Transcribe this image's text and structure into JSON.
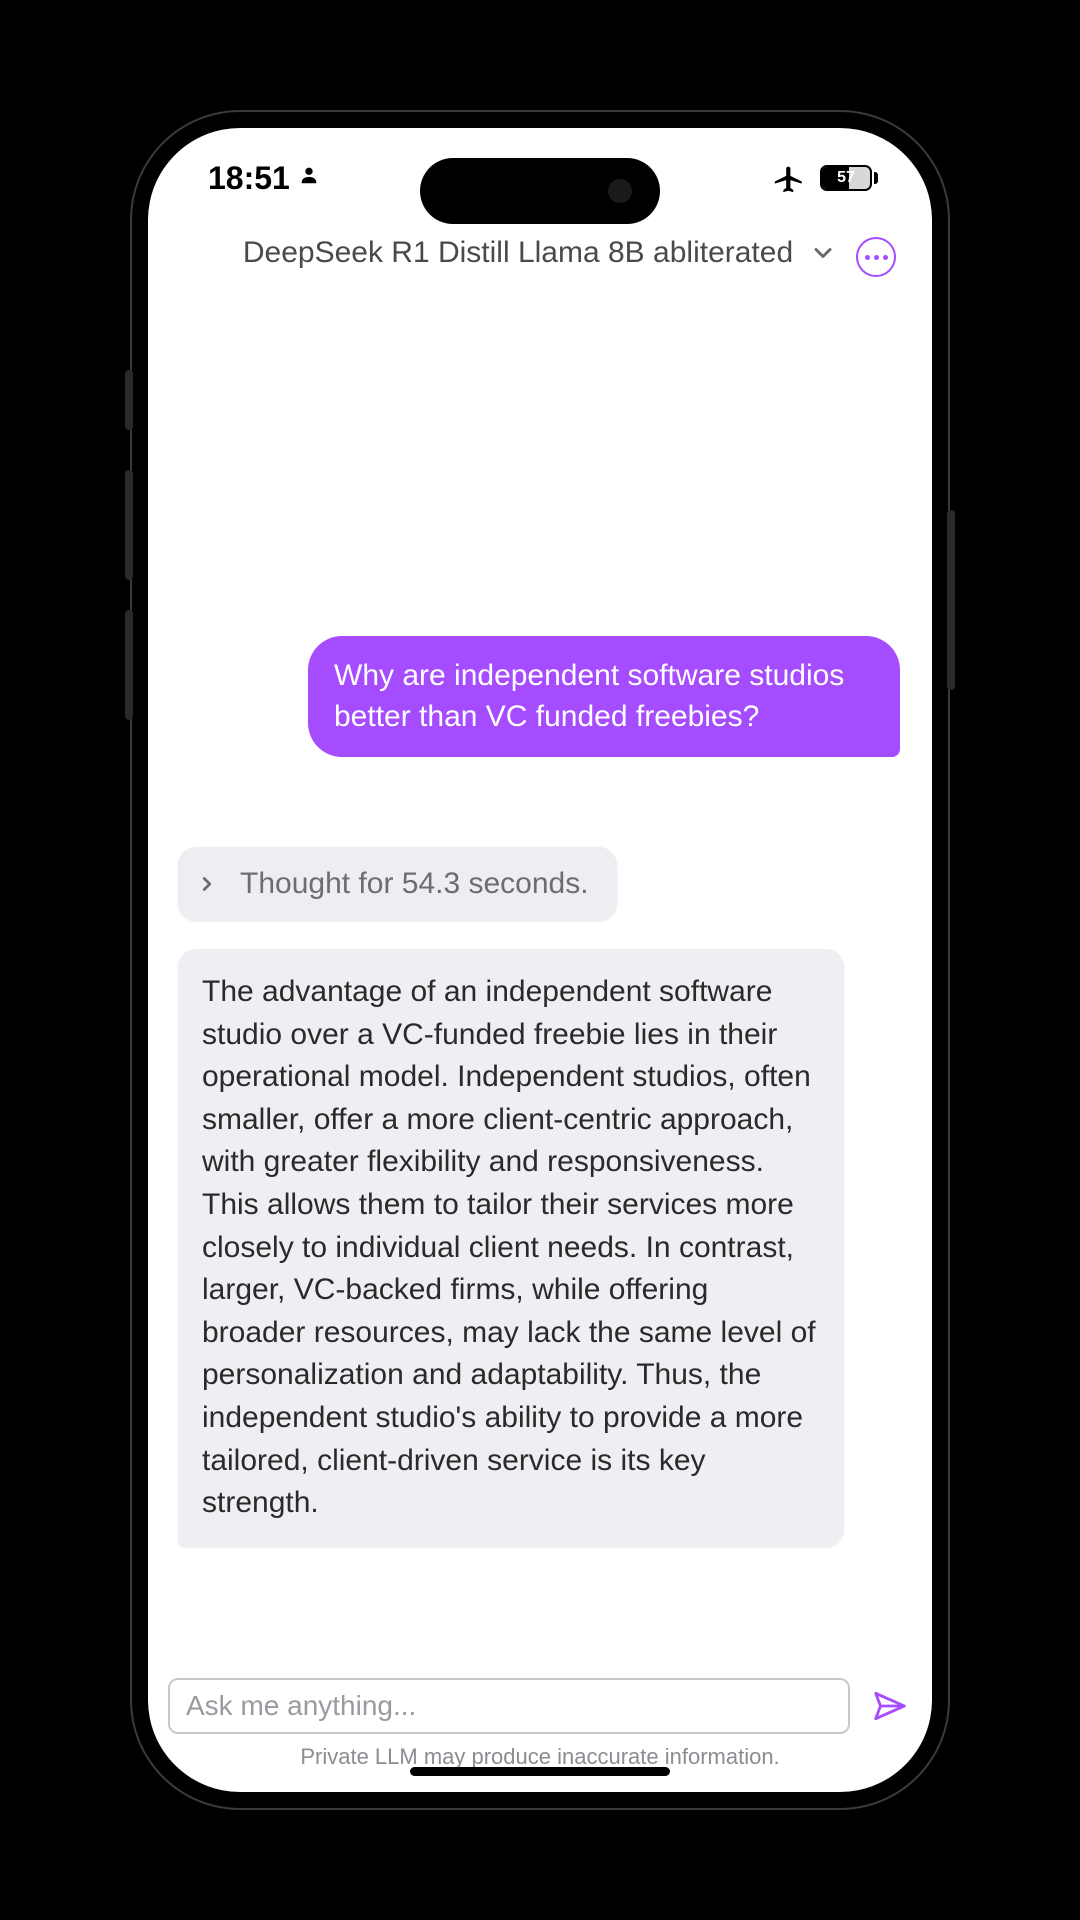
{
  "status": {
    "time": "18:51",
    "battery_pct": "57"
  },
  "header": {
    "model_name": "DeepSeek R1 Distill Llama 8B abliterated"
  },
  "chat": {
    "user_message": "Why are independent software studios better than VC funded freebies?",
    "thought_label": "Thought for 54.3 seconds.",
    "assistant_message": "The advantage of an independent software studio over a VC-funded freebie lies in their operational model. Independent studios, often smaller, offer a more client-centric approach, with greater flexibility and responsiveness. This allows them to tailor their services more closely to individual client needs. In contrast, larger, VC-backed firms, while offering broader resources, may lack the same level of personalization and adaptability. Thus, the independent studio's ability to provide a more tailored, client-driven service is its key strength."
  },
  "input": {
    "placeholder": "Ask me anything..."
  },
  "footer": {
    "disclaimer": "Private LLM may produce inaccurate information."
  }
}
